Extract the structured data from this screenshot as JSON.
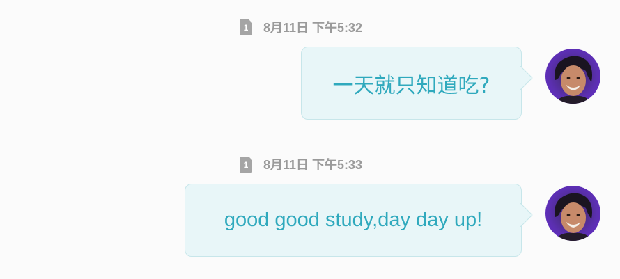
{
  "messages": [
    {
      "timestamp": "8月11日 下午5:32",
      "sim_slot": "1",
      "text": "一天就只知道吃?"
    },
    {
      "timestamp": "8月11日 下午5:33",
      "sim_slot": "1",
      "text": "good good study,day day up!"
    }
  ],
  "colors": {
    "background": "#fbfbfb",
    "bubble_fill": "#e8f6f8",
    "bubble_border": "#c7e6ea",
    "bubble_text": "#2fa9bd",
    "timestamp_text": "#9a9a9a",
    "sim_icon": "#a5a5a5"
  },
  "icons": {
    "sim": "sim-card-icon",
    "avatar": "user-avatar"
  }
}
